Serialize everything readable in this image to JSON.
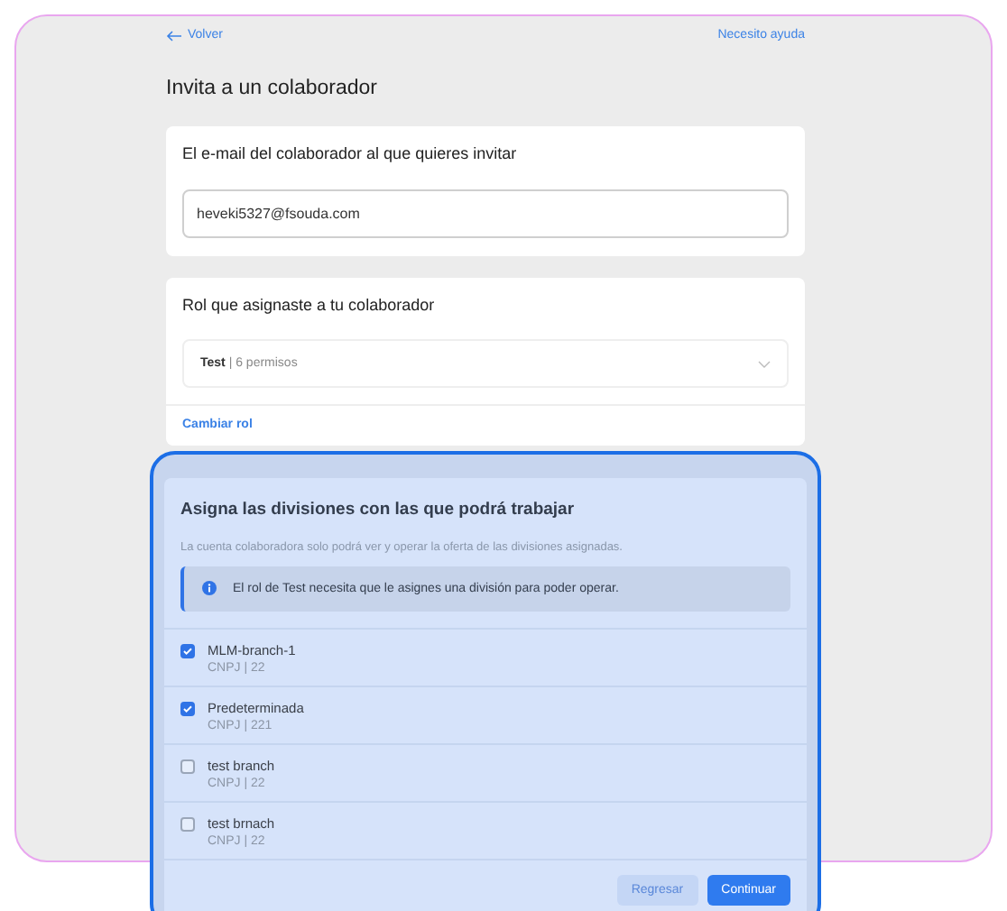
{
  "nav": {
    "back": "Volver",
    "help": "Necesito ayuda"
  },
  "title": "Invita a un colaborador",
  "email_card": {
    "heading": "El e-mail del colaborador al que quieres invitar",
    "value": "heveki5327@fsouda.com"
  },
  "role_card": {
    "heading": "Rol que asignaste a tu colaborador",
    "role": "**Test** | 6 permisos",
    "change_link": "Cambiar rol"
  },
  "divisions_card": {
    "heading": "Asigna las divisiones con las que podrá trabajar",
    "subtitle": "La cuenta colaboradora solo podrá ver y operar la oferta de las divisiones asignadas.",
    "notice": "El rol de Test necesita que le asignes una división para poder operar.",
    "items": [
      {
        "name": "MLM-branch-1",
        "detail": "CNPJ | 22",
        "checked": true
      },
      {
        "name": "Predeterminada",
        "detail": "CNPJ | 221",
        "checked": true
      },
      {
        "name": "test branch",
        "detail": "CNPJ | 22",
        "checked": false
      },
      {
        "name": "test brnach",
        "detail": "CNPJ | 22",
        "checked": false
      }
    ],
    "buttons": [
      {
        "label": "Regresar",
        "kind": "secondary"
      },
      {
        "label": "Continuar",
        "kind": "primary"
      }
    ]
  }
}
